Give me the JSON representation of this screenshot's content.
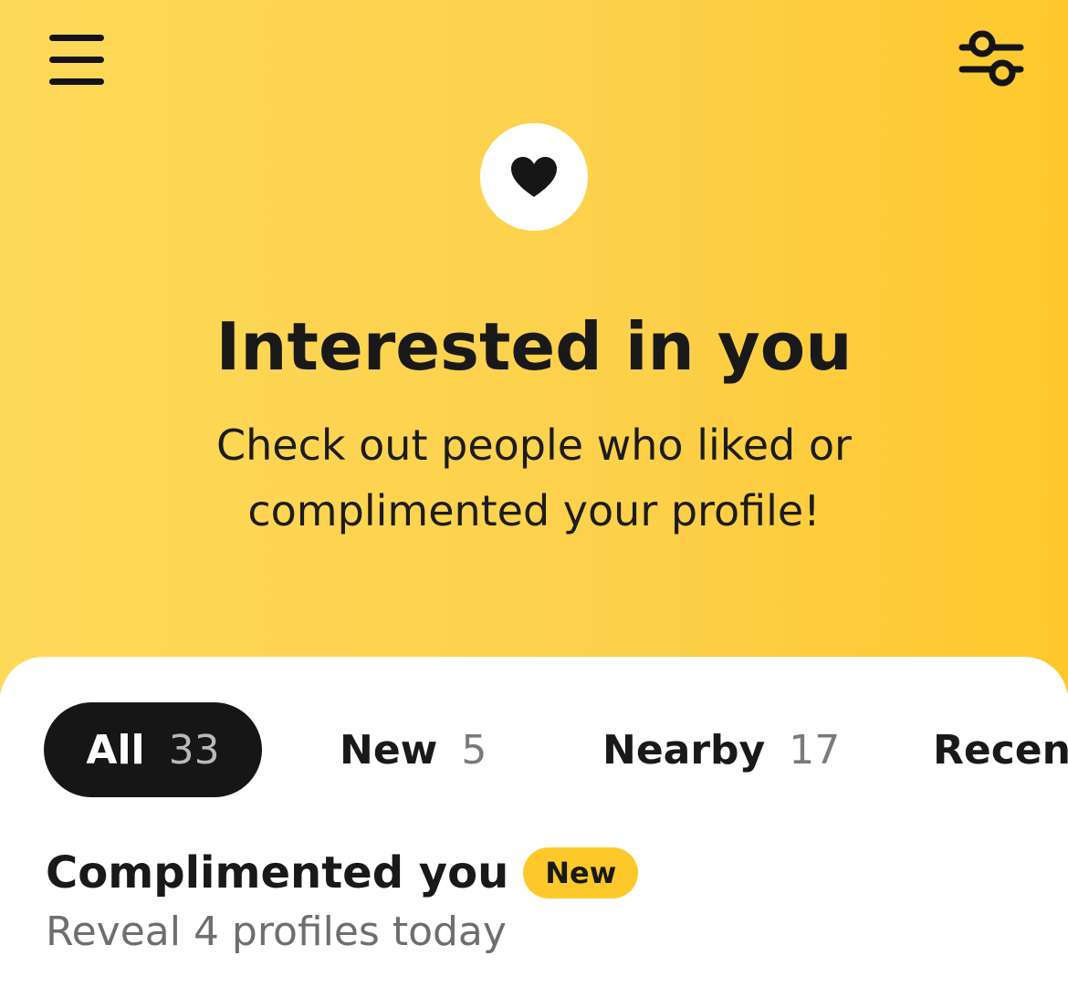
{
  "header": {
    "menu_icon": "hamburger-menu-icon",
    "filter_icon": "sliders-filter-icon"
  },
  "hero": {
    "icon": "heart-icon",
    "title": "Interested in you",
    "subtitle": "Check out people who liked or complimented your profile!"
  },
  "tabs": [
    {
      "label": "All",
      "count": "33",
      "active": true
    },
    {
      "label": "New",
      "count": "5",
      "active": false
    },
    {
      "label": "Nearby",
      "count": "17",
      "active": false
    },
    {
      "label": "Recent",
      "count": "",
      "active": false
    }
  ],
  "section": {
    "title": "Complimented you",
    "badge": "New",
    "subtitle": "Reveal 4 profiles today"
  },
  "colors": {
    "hero_gradient_start": "#FDD959",
    "hero_gradient_end": "#FEC82C",
    "badge": "#FDC829",
    "active_tab": "#161616",
    "text_dark": "#191919",
    "text_muted": "#6e6e6e"
  }
}
